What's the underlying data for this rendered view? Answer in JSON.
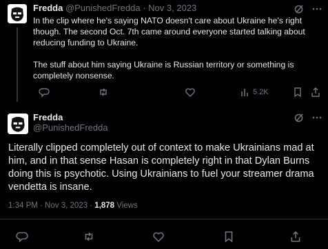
{
  "tweet1": {
    "name": "Fredda",
    "handle": "@PunishedFredda",
    "separator": "·",
    "date": "Nov 3, 2023",
    "paragraphs": [
      "In the clip where he's saying NATO doesn't care about Ukraine he's right though. The second Oct. 7th came around everyone started talking about reducing funding to Ukraine.",
      "The stuff about him saying Ukraine is Russian territory or something is completely nonsense."
    ],
    "views": "5.2K"
  },
  "tweet2": {
    "name": "Fredda",
    "handle": "@PunishedFredda",
    "body": "Literally clipped completely out of context to make Ukrainians mad at him, and in that sense Hasan is completely right in that Dylan Burns doing this is psychotic. Using Ukrainians to fuel your streamer drama vendetta is insane.",
    "time": "1:34 PM · Nov 3, 2023 · ",
    "views_count": "1,878",
    "views_label": " Views"
  },
  "icons": [
    "grok-icon",
    "more-icon",
    "reply-icon",
    "retweet-icon",
    "like-icon",
    "views-icon",
    "bookmark-icon",
    "share-icon"
  ],
  "colors": {
    "background": "#000000",
    "text": "#e7e9ea",
    "muted": "#71767b",
    "divider": "#2f3336"
  }
}
